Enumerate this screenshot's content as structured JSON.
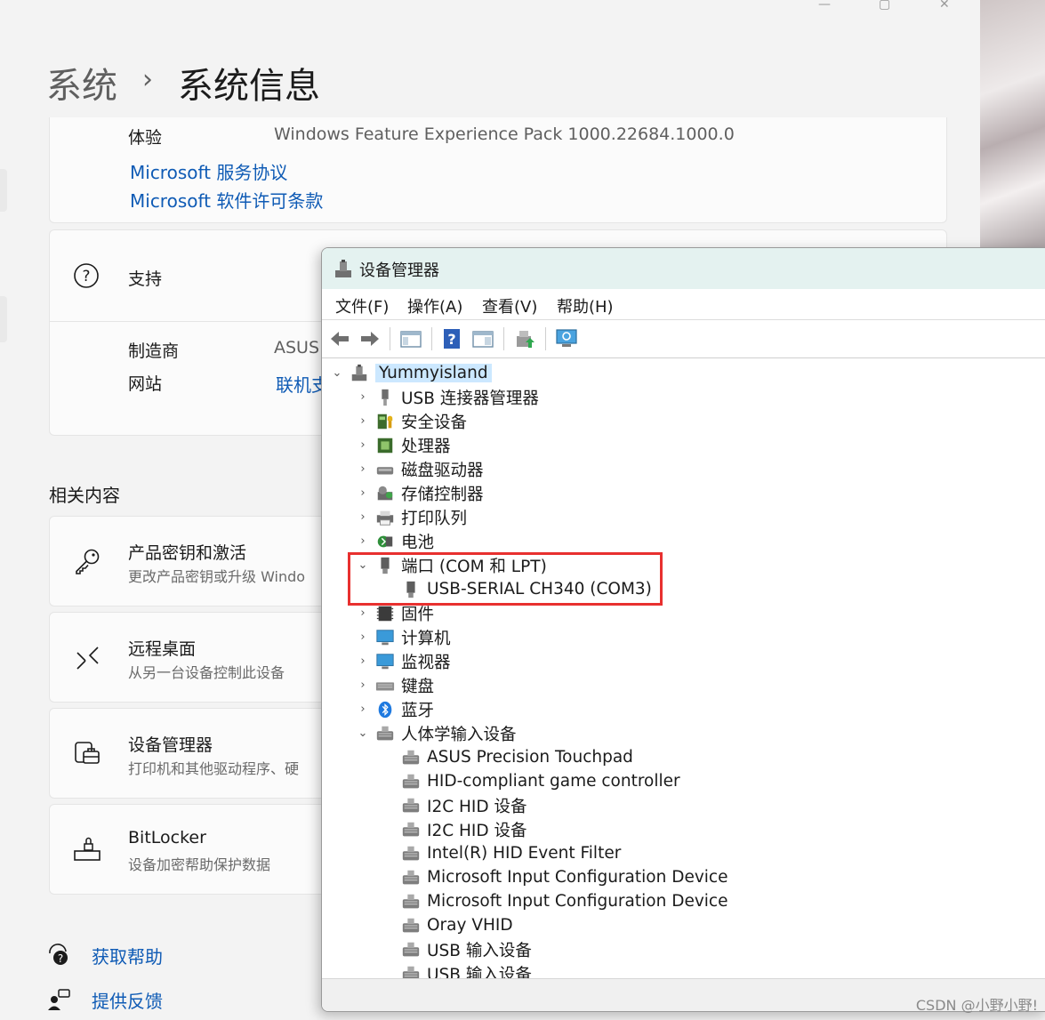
{
  "settings": {
    "breadcrumb_parent": "系统",
    "breadcrumb_sep": "›",
    "breadcrumb_current": "系统信息",
    "experience_label": "体验",
    "experience_value": "Windows Feature Experience Pack 1000.22684.1000.0",
    "link_service": "Microsoft 服务协议",
    "link_license": "Microsoft 软件许可条款",
    "support_title": "支持",
    "manufacturer_label": "制造商",
    "manufacturer_value": "ASUS",
    "website_label": "网站",
    "website_value": "联机支",
    "related_title": "相关内容",
    "related": [
      {
        "title": "产品密钥和激活",
        "subtitle": "更改产品密钥或升级 Windo",
        "icon": "key-icon"
      },
      {
        "title": "远程桌面",
        "subtitle": "从另一台设备控制此设备",
        "icon": "remote-desktop-icon"
      },
      {
        "title": "设备管理器",
        "subtitle": "打印机和其他驱动程序、硬",
        "icon": "device-manager-icon"
      },
      {
        "title": "BitLocker",
        "subtitle": "设备加密帮助保护数据",
        "icon": "bitlocker-icon"
      }
    ],
    "help_link": "获取帮助",
    "feedback_link": "提供反馈"
  },
  "device_manager": {
    "title": "设备管理器",
    "menu": [
      "文件(F)",
      "操作(A)",
      "查看(V)",
      "帮助(H)"
    ],
    "root": "Yummyisland",
    "tree": [
      {
        "label": "USB 连接器管理器",
        "icon": "usb-connector-icon",
        "expanded": false
      },
      {
        "label": "安全设备",
        "icon": "security-device-icon",
        "expanded": false
      },
      {
        "label": "处理器",
        "icon": "processor-icon",
        "expanded": false
      },
      {
        "label": "磁盘驱动器",
        "icon": "disk-drive-icon",
        "expanded": false
      },
      {
        "label": "存储控制器",
        "icon": "storage-controller-icon",
        "expanded": false
      },
      {
        "label": "打印队列",
        "icon": "printer-icon",
        "expanded": false
      },
      {
        "label": "电池",
        "icon": "battery-icon",
        "expanded": false
      },
      {
        "label": "端口 (COM 和 LPT)",
        "icon": "port-icon",
        "expanded": true,
        "children": [
          "USB-SERIAL CH340 (COM3)"
        ]
      },
      {
        "label": "固件",
        "icon": "firmware-icon",
        "expanded": false
      },
      {
        "label": "计算机",
        "icon": "computer-icon",
        "expanded": false
      },
      {
        "label": "监视器",
        "icon": "monitor-icon",
        "expanded": false
      },
      {
        "label": "键盘",
        "icon": "keyboard-icon",
        "expanded": false
      },
      {
        "label": "蓝牙",
        "icon": "bluetooth-icon",
        "expanded": false
      },
      {
        "label": "人体学输入设备",
        "icon": "hid-icon",
        "expanded": true,
        "children": [
          "ASUS Precision Touchpad",
          "HID-compliant game controller",
          "I2C HID 设备",
          "I2C HID 设备",
          "Intel(R) HID Event Filter",
          "Microsoft Input Configuration Device",
          "Microsoft Input Configuration Device",
          "Oray VHID",
          "USB 输入设备",
          "USB 输入设备"
        ]
      }
    ]
  },
  "watermark": "CSDN @小野小野!",
  "colors": {
    "link": "#0f5bb5",
    "highlight": "#e8302f",
    "title_bar": "#e4f2f0",
    "selection": "#cce8ff"
  }
}
